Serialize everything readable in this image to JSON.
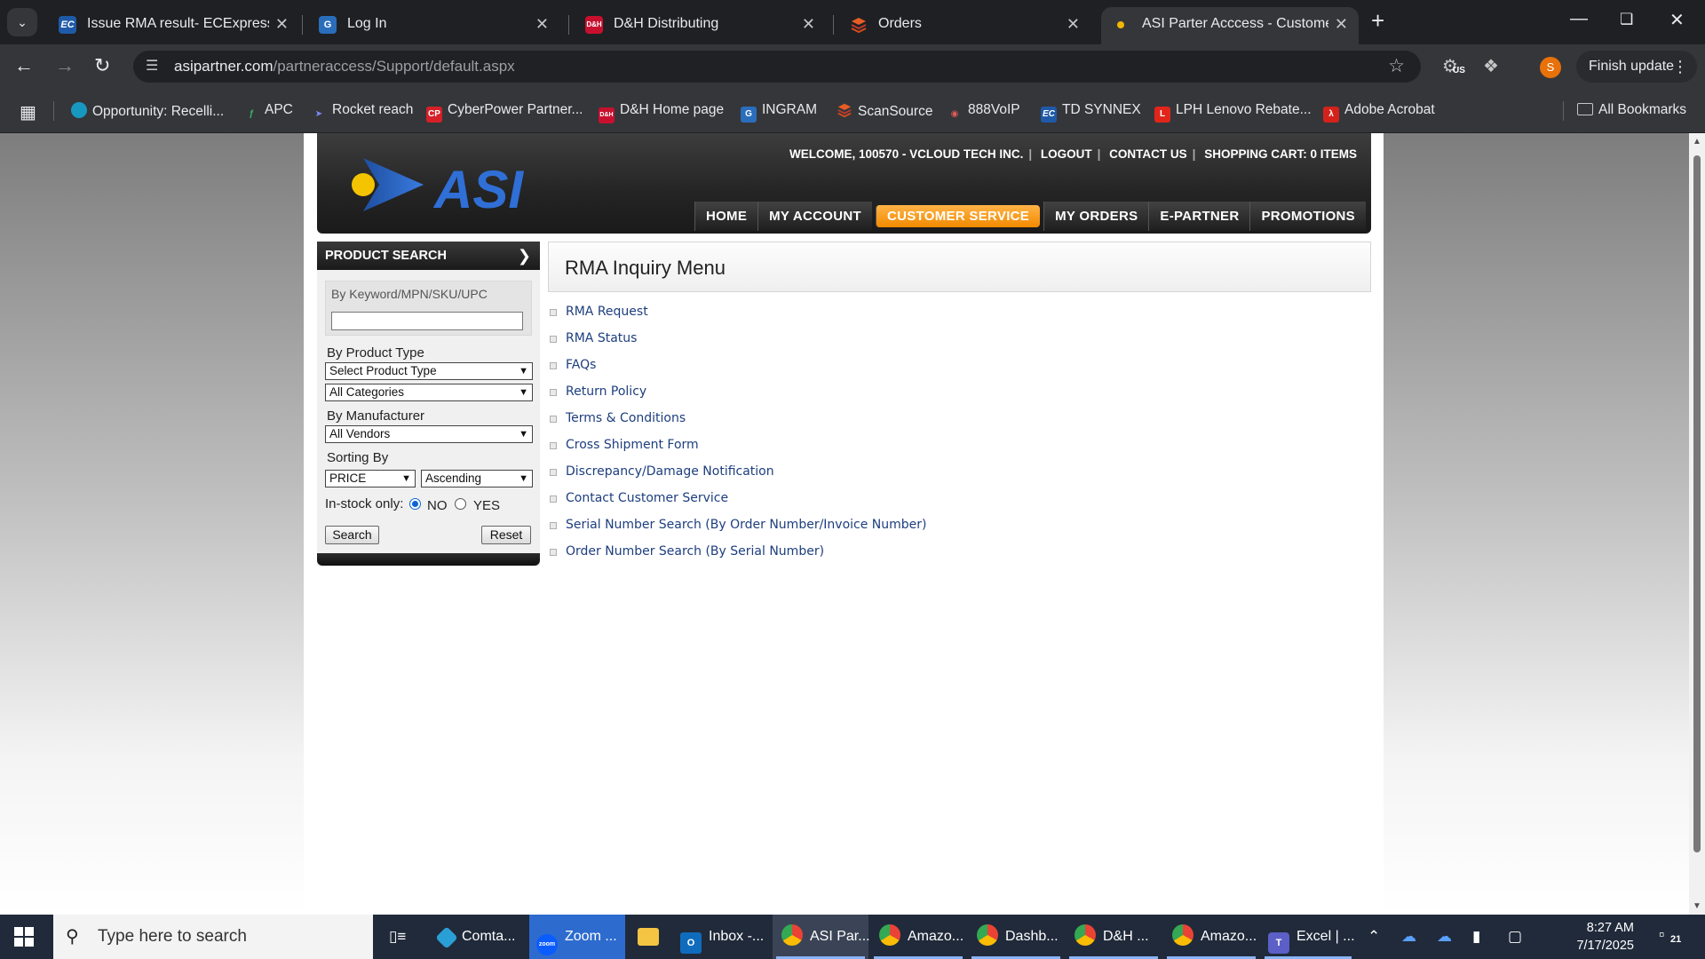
{
  "browser": {
    "tabs": [
      {
        "title": "Issue RMA result- ECExpress - T",
        "favicon": "EC",
        "favicon_color": "#1e5aa8",
        "active": false
      },
      {
        "title": "Log In",
        "favicon": "G",
        "favicon_color": "#2a6ebb",
        "active": false
      },
      {
        "title": "D&H Distributing",
        "favicon": "D&H",
        "favicon_color": "#c8102e",
        "active": false
      },
      {
        "title": "Orders",
        "favicon": "stack-icon",
        "favicon_color": "#d84a1b",
        "active": false
      },
      {
        "title": "ASI Parter Acccess - Customer S",
        "favicon": "dot",
        "favicon_color": "#f2b600",
        "active": true
      }
    ],
    "url_host": "asipartner.com",
    "url_path": "/partneraccess/Support/default.aspx",
    "finish_update_label": "Finish update",
    "profile_initial": "S",
    "extension_badge": "US",
    "bookmarks": [
      {
        "label": "Opportunity: Recelli...",
        "icon": "salesforce-cloud-icon",
        "color": "#1798c1"
      },
      {
        "label": "APC",
        "icon": "apc-icon",
        "color": "#2e8b57"
      },
      {
        "label": "Rocket reach",
        "icon": "rocket-icon",
        "color": "#5b6bd6"
      },
      {
        "label": "CyberPower Partner...",
        "icon": "CP",
        "color": "#d62027"
      },
      {
        "label": "D&H Home page",
        "icon": "D&H",
        "color": "#c8102e"
      },
      {
        "label": "INGRAM",
        "icon": "G",
        "color": "#2a6ebb"
      },
      {
        "label": "ScanSource",
        "icon": "stack-icon",
        "color": "#d84a1b"
      },
      {
        "label": "888VoIP",
        "icon": "headset-icon",
        "color": "#b02020"
      },
      {
        "label": "TD SYNNEX",
        "icon": "EC",
        "color": "#1e5aa8"
      },
      {
        "label": "LPH Lenovo Rebate...",
        "icon": "L",
        "color": "#e1251b"
      },
      {
        "label": "Adobe Acrobat",
        "icon": "acrobat-icon",
        "color": "#d4221a"
      }
    ],
    "all_bookmarks_label": "All Bookmarks"
  },
  "site": {
    "brand": "ASI",
    "user_links": [
      "WELCOME, 100570 - VCLOUD TECH INC.",
      "LOGOUT",
      "CONTACT US",
      "SHOPPING CART: 0 ITEMS"
    ],
    "nav": [
      {
        "label": "HOME",
        "active": false
      },
      {
        "label": "MY ACCOUNT",
        "active": false
      },
      {
        "label": "CUSTOMER SERVICE",
        "active": true
      },
      {
        "label": "MY ORDERS",
        "active": false
      },
      {
        "label": "E-PARTNER",
        "active": false
      },
      {
        "label": "PROMOTIONS",
        "active": false
      }
    ],
    "colors": {
      "accent": "#f28a00",
      "link": "#1d3e7e",
      "header_bg": "#242424"
    }
  },
  "product_search": {
    "title": "PRODUCT SEARCH",
    "keyword_label": "By Keyword/MPN/SKU/UPC",
    "keyword_value": "",
    "product_type_label": "By Product Type",
    "product_type_value": "Select Product Type",
    "category_value": "All Categories",
    "manufacturer_label": "By Manufacturer",
    "manufacturer_value": "All Vendors",
    "sorting_label": "Sorting By",
    "sort_field_value": "PRICE",
    "sort_order_value": "Ascending",
    "instock_label": "In-stock only:",
    "instock_no": "NO",
    "instock_yes": "YES",
    "instock_selected": "NO",
    "search_button": "Search",
    "reset_button": "Reset"
  },
  "rma_menu": {
    "title": "RMA Inquiry Menu",
    "items": [
      "RMA Request",
      "RMA Status",
      "FAQs",
      "Return Policy",
      "Terms & Conditions",
      "Cross Shipment Form",
      "Discrepancy/Damage Notification",
      "Contact Customer Service",
      "Serial Number Search (By Order Number/Invoice Number)",
      "Order Number Search (By Serial Number)"
    ]
  },
  "taskbar": {
    "search_placeholder": "Type here to search",
    "apps": [
      {
        "label": "Comta...",
        "icon": "comta-icon"
      },
      {
        "label": "Zoom ...",
        "icon": "zoom-icon"
      },
      {
        "label": "",
        "icon": "file-explorer-icon"
      },
      {
        "label": "Inbox -...",
        "icon": "outlook-icon"
      },
      {
        "label": "ASI Par...",
        "icon": "chrome-icon"
      },
      {
        "label": "Amazo...",
        "icon": "chrome-icon"
      },
      {
        "label": "Dashb...",
        "icon": "chrome-icon"
      },
      {
        "label": "D&H ...",
        "icon": "chrome-icon"
      },
      {
        "label": "Amazo...",
        "icon": "chrome-icon"
      },
      {
        "label": "Excel | ...",
        "icon": "teams-icon"
      }
    ],
    "time": "8:27 AM",
    "date": "7/17/2025",
    "notification_count": "21"
  }
}
